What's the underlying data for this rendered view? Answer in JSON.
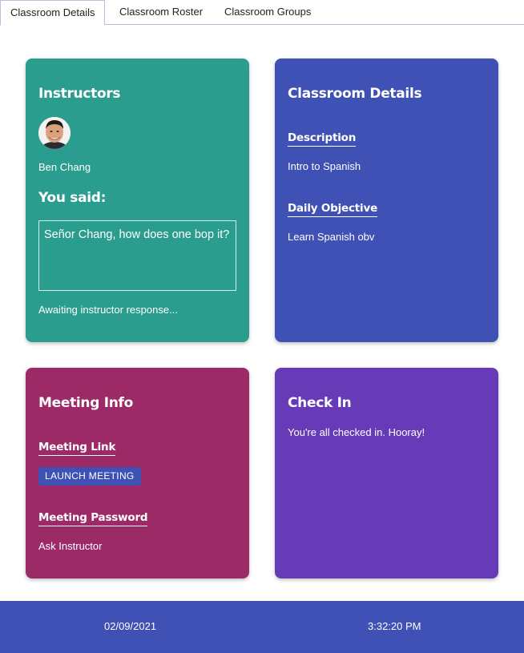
{
  "tabs": [
    {
      "label": "Classroom Details",
      "active": true
    },
    {
      "label": "Classroom Roster",
      "active": false
    },
    {
      "label": "Classroom Groups",
      "active": false
    }
  ],
  "instructors": {
    "title": "Instructors",
    "avatar_icon": "instructor-avatar",
    "name": "Ben Chang",
    "you_said_label": "You said:",
    "message": "Señor Chang, how does one bop it?",
    "status": "Awaiting instructor response..."
  },
  "classroom_details": {
    "title": "Classroom Details",
    "description_label": "Description",
    "description": "Intro to Spanish",
    "objective_label": "Daily Objective",
    "objective": "Learn Spanish obv"
  },
  "meeting_info": {
    "title": "Meeting Info",
    "link_label": "Meeting Link",
    "launch_button": "LAUNCH MEETING",
    "password_label": "Meeting Password",
    "password": "Ask Instructor"
  },
  "check_in": {
    "title": "Check In",
    "message": "You're all checked in. Hooray!"
  },
  "footer": {
    "date": "02/09/2021",
    "time": "3:32:20 PM"
  },
  "colors": {
    "teal": "#2a9d8f",
    "blue": "#3f51b5",
    "magenta": "#9c2a67",
    "purple": "#673ab7"
  }
}
